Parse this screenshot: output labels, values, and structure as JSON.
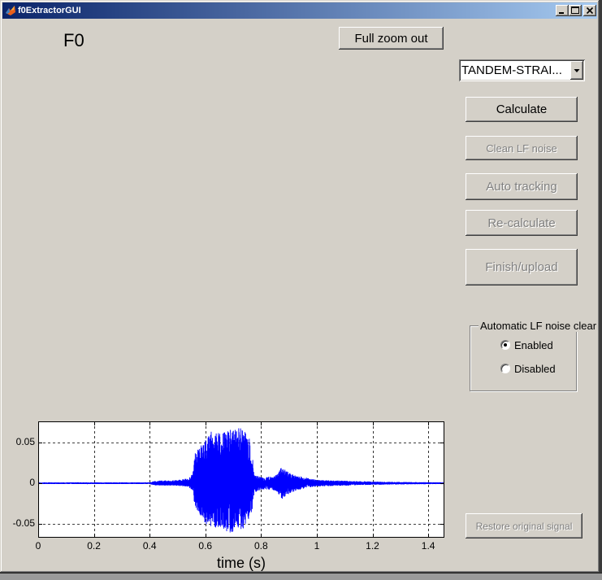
{
  "window": {
    "title": "f0ExtractorGUI",
    "icon": "matlab-icon",
    "controls": [
      "minimize-icon",
      "maximize-icon",
      "close-icon"
    ]
  },
  "f0_label": "F0",
  "toolbar": {
    "full_zoom_out": {
      "label": "Full zoom out",
      "enabled": true
    }
  },
  "algorithm_select": {
    "selected": "TANDEM-STRAI...",
    "icon": "chevron-down-icon"
  },
  "actions": {
    "calculate": {
      "label": "Calculate",
      "enabled": true
    },
    "clean_lf_noise": {
      "label": "Clean LF noise",
      "enabled": false
    },
    "auto_tracking": {
      "label": "Auto tracking",
      "enabled": false
    },
    "recalculate": {
      "label": "Re-calculate",
      "enabled": false
    },
    "finish_upload": {
      "label": "Finish/upload",
      "enabled": false
    }
  },
  "lf_noise_panel": {
    "title": "Automatic LF noise clear",
    "options": [
      {
        "label": "Enabled",
        "selected": true
      },
      {
        "label": "Disabled",
        "selected": false
      }
    ]
  },
  "restore_button": {
    "label": "Restore original signal",
    "enabled": false
  },
  "colors": {
    "window_bg": "#d4d0c8",
    "title_bar_start": "#0a246a",
    "title_bar_end": "#a6caf0",
    "disabled_text": "#808080",
    "plot_bg": "#ffffff",
    "grid": "#000000",
    "waveform": "#0000ff"
  },
  "chart_data": {
    "type": "line",
    "title": "",
    "xlabel": "time (s)",
    "ylabel": "",
    "xlim": [
      0,
      1.458
    ],
    "ylim": [
      -0.067,
      0.076
    ],
    "xticks": [
      0,
      0.2,
      0.4,
      0.6,
      0.8,
      1,
      1.2,
      1.4
    ],
    "xtick_labels": [
      "0",
      "0.2",
      "0.4",
      "0.6",
      "0.8",
      "1",
      "1.2",
      "1.4"
    ],
    "yticks": [
      0.05,
      0,
      -0.05
    ],
    "ytick_labels": [
      "0.05",
      "0",
      "-0.05"
    ],
    "grid": true,
    "series": [
      {
        "color": "#0000ff",
        "envelope": [
          {
            "t": 0,
            "max": 0.001,
            "min": -0.001
          },
          {
            "t": 0.4,
            "max": 0.001,
            "min": -0.001
          },
          {
            "t": 0.42,
            "max": 0.003,
            "min": -0.003
          },
          {
            "t": 0.5,
            "max": 0.004,
            "min": -0.003
          },
          {
            "t": 0.54,
            "max": 0.006,
            "min": -0.005
          },
          {
            "t": 0.555,
            "max": 0.012,
            "min": -0.01
          },
          {
            "t": 0.56,
            "max": 0.035,
            "min": -0.028
          },
          {
            "t": 0.58,
            "max": 0.045,
            "min": -0.04
          },
          {
            "t": 0.6,
            "max": 0.055,
            "min": -0.05
          },
          {
            "t": 0.62,
            "max": 0.064,
            "min": -0.053
          },
          {
            "t": 0.64,
            "max": 0.066,
            "min": -0.055
          },
          {
            "t": 0.66,
            "max": 0.062,
            "min": -0.055
          },
          {
            "t": 0.68,
            "max": 0.065,
            "min": -0.06
          },
          {
            "t": 0.7,
            "max": 0.068,
            "min": -0.062
          },
          {
            "t": 0.72,
            "max": 0.068,
            "min": -0.06
          },
          {
            "t": 0.74,
            "max": 0.066,
            "min": -0.055
          },
          {
            "t": 0.76,
            "max": 0.055,
            "min": -0.045
          },
          {
            "t": 0.77,
            "max": 0.03,
            "min": -0.03
          },
          {
            "t": 0.775,
            "max": 0.01,
            "min": -0.012
          },
          {
            "t": 0.8,
            "max": 0.008,
            "min": -0.008
          },
          {
            "t": 0.84,
            "max": 0.008,
            "min": -0.008
          },
          {
            "t": 0.86,
            "max": 0.012,
            "min": -0.012
          },
          {
            "t": 0.875,
            "max": 0.022,
            "min": -0.02
          },
          {
            "t": 0.89,
            "max": 0.015,
            "min": -0.015
          },
          {
            "t": 0.92,
            "max": 0.01,
            "min": -0.01
          },
          {
            "t": 0.96,
            "max": 0.007,
            "min": -0.006
          },
          {
            "t": 1.0,
            "max": 0.004,
            "min": -0.004
          },
          {
            "t": 1.1,
            "max": 0.003,
            "min": -0.003
          },
          {
            "t": 1.2,
            "max": 0.002,
            "min": -0.002
          },
          {
            "t": 1.3,
            "max": 0.0015,
            "min": -0.0015
          },
          {
            "t": 1.458,
            "max": 0.001,
            "min": -0.001
          }
        ]
      }
    ]
  }
}
